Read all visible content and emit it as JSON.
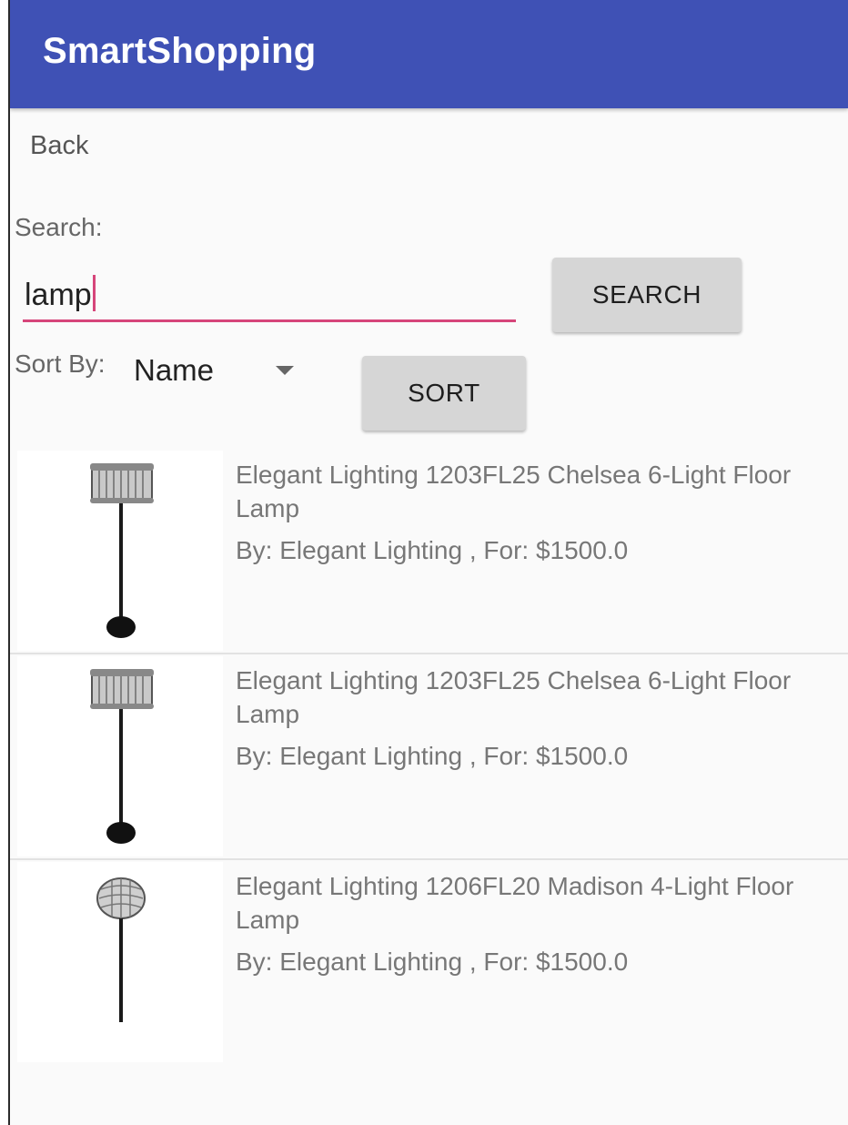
{
  "app": {
    "title": "SmartShopping"
  },
  "nav": {
    "back_label": "Back"
  },
  "search": {
    "label": "Search:",
    "value": "lamp",
    "button_label": "SEARCH"
  },
  "sort": {
    "label": "Sort By:",
    "selected": "Name",
    "button_label": "SORT"
  },
  "results": [
    {
      "title": "Elegant Lighting 1203FL25 Chelsea 6-Light Floor Lamp",
      "meta": "By: Elegant Lighting , For: $1500.0",
      "image_icon": "floor-lamp-icon"
    },
    {
      "title": "Elegant Lighting 1203FL25 Chelsea 6-Light Floor Lamp",
      "meta": "By: Elegant Lighting , For: $1500.0",
      "image_icon": "floor-lamp-icon"
    },
    {
      "title": "Elegant Lighting 1206FL20 Madison 4-Light Floor Lamp",
      "meta": "By: Elegant Lighting , For: $1500.0",
      "image_icon": "floor-lamp-icon"
    }
  ],
  "colors": {
    "app_bar": "#3f51b5",
    "accent": "#d6457a",
    "button": "#d6d6d6",
    "background": "#fafafa"
  }
}
